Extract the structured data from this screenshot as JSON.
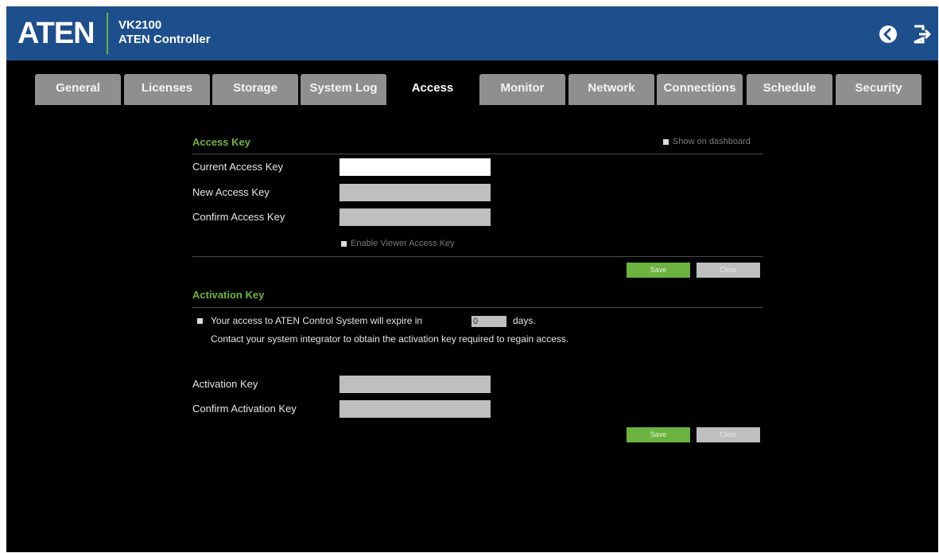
{
  "header": {
    "logo": "ATEN",
    "model": "VK2100",
    "app_name": "ATEN Controller",
    "icons": [
      "back-icon",
      "logout-icon"
    ],
    "brand_color": "#1d4f8c",
    "accent_color": "#6db33f"
  },
  "tabs": [
    {
      "label": "General"
    },
    {
      "label": "Licenses"
    },
    {
      "label": "Storage"
    },
    {
      "label": "System Log"
    },
    {
      "label": "Access",
      "active": true
    },
    {
      "label": "Monitor"
    },
    {
      "label": "Network"
    },
    {
      "label": "Connections"
    },
    {
      "label": "Schedule"
    },
    {
      "label": "Security"
    }
  ],
  "access_key": {
    "title": "Access Key",
    "show_on_dashboard": "Show on dashboard",
    "current_label": "Current Access Key",
    "new_label": "New Access Key",
    "confirm_label": "Confirm Access Key",
    "enable_viewer": "Enable Viewer Access Key",
    "save_label": "Save",
    "clear_label": "Clear"
  },
  "activation_key": {
    "title": "Activation Key",
    "expire_prefix": "Your access to ATEN Control System will expire in",
    "expire_days_value": "0",
    "expire_suffix": "days.",
    "contact_text": "Contact your system integrator to obtain the activation key required to regain access.",
    "activation_label": "Activation Key",
    "confirm_label": "Confirm Activation Key",
    "save_label": "Save",
    "clear_label": "Clear"
  }
}
